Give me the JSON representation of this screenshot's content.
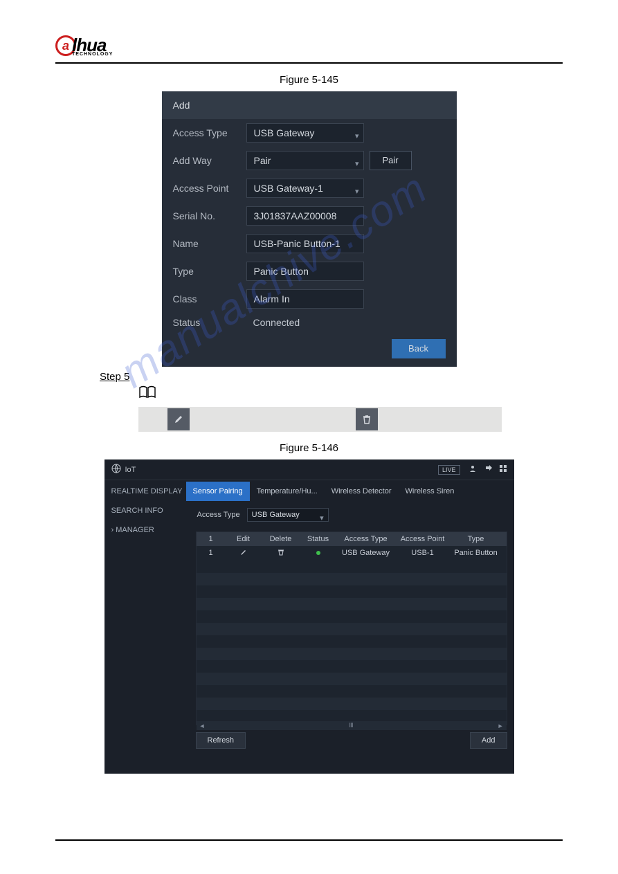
{
  "logo": {
    "text": "lhua",
    "sub": "TECHNOLOGY"
  },
  "fig1": "Figure 5-145",
  "add_dialog": {
    "title": "Add",
    "labels": {
      "access_type": "Access Type",
      "add_way": "Add Way",
      "access_point": "Access Point",
      "serial": "Serial No.",
      "name": "Name",
      "type": "Type",
      "class": "Class",
      "status": "Status"
    },
    "values": {
      "access_type": "USB Gateway",
      "add_way": "Pair",
      "access_point": "USB Gateway-1",
      "serial": "3J01837AAZ00008",
      "name": "USB-Panic Button-1",
      "type": "Panic Button",
      "class": "Alarm In",
      "status": "Connected"
    },
    "pair_btn": "Pair",
    "back_btn": "Back"
  },
  "step5": "Step 5",
  "fig2": "Figure 5-146",
  "iot": {
    "title": "IoT",
    "live": "LIVE",
    "side": {
      "realtime": "REALTIME DISPLAY",
      "search": "SEARCH INFO",
      "manager": "MANAGER"
    },
    "tabs": {
      "sensor": "Sensor Pairing",
      "temp": "Temperature/Hu...",
      "detector": "Wireless Detector",
      "siren": "Wireless Siren"
    },
    "filter_label": "Access Type",
    "filter_value": "USB Gateway",
    "columns": {
      "idx": "1",
      "edit": "Edit",
      "del": "Delete",
      "status": "Status",
      "atype": "Access Type",
      "apoint": "Access Point",
      "type": "Type"
    },
    "row": {
      "idx": "1",
      "atype": "USB Gateway",
      "apoint": "USB-1",
      "type": "Panic Button"
    },
    "refresh": "Refresh",
    "add": "Add"
  },
  "watermark": "manualchive.com"
}
